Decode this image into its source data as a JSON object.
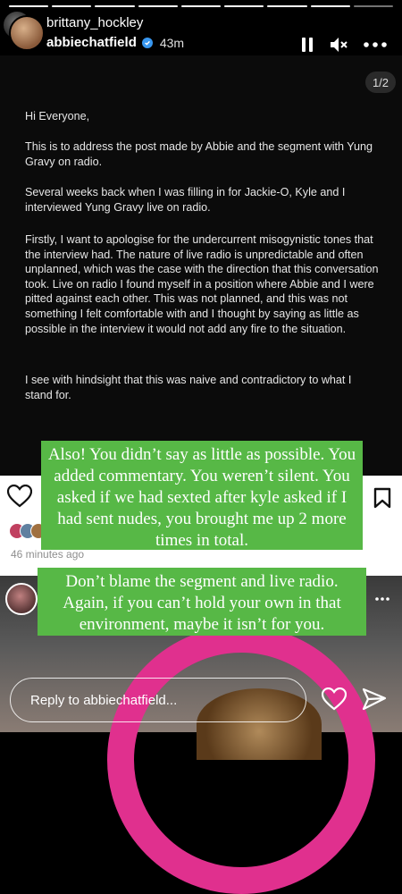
{
  "header": {
    "username_top": "brittany_hockley",
    "username": "abbiechatfield",
    "time": "43m"
  },
  "progress": {
    "segments": 9,
    "current_index": 7
  },
  "document": {
    "page_indicator": "1/2",
    "paragraphs": [
      "Hi Everyone,",
      "This is to address the post made by Abbie and the segment with Yung Gravy on radio.",
      "Several weeks back when I was filling in for Jackie-O, Kyle and I interviewed Yung Gravy live on radio.",
      "Firstly, I want to apologise for the undercurrent misogynistic tones that the interview had.  The nature of live radio is unpredictable and often unplanned, which was the case with the direction that this conversation took.   Live on radio I found myself in a position where Abbie and I were pitted against each other. This was not planned, and this was not something I felt comfortable with and I thought by saying as little as possible in the interview it would not add any fire to the situation.",
      "I see with hindsight that this was naive and contradictory to what I stand for."
    ]
  },
  "post_meta": {
    "time_ago": "46 minutes ago"
  },
  "comments": {
    "box1": "Also! You didn’t say as little as possible. You added commentary. You weren’t silent. You asked if we had sexted after kyle asked if I had sent nudes, you brought me up 2 more times in total.",
    "box2": "Don’t blame the segment and live radio. Again, if you can’t hold your own in that environment, maybe it isn’t for you."
  },
  "reply": {
    "placeholder": "Reply to abbiechatfield..."
  },
  "colors": {
    "green": "#57b846",
    "pink_ring": "#e0308e",
    "verified_blue": "#3897f0"
  }
}
